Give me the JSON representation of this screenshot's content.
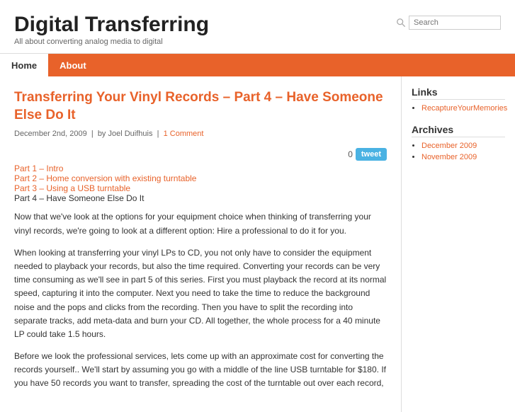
{
  "site": {
    "title": "Digital Transferring",
    "tagline": "All about converting analog media to digital",
    "search_placeholder": "Search"
  },
  "nav": {
    "items": [
      {
        "label": "Home",
        "active": true
      },
      {
        "label": "About",
        "active": false
      }
    ]
  },
  "post": {
    "title": "Transferring Your Vinyl Records – Part 4 – Have Someone Else Do It",
    "date": "December 2nd, 2009",
    "author": "Joel Duifhuis",
    "comment_label": "1 Comment",
    "tweet_count": "0",
    "tweet_button_label": "tweet",
    "nav_links": [
      {
        "label": "Part 1 – Intro",
        "linked": true
      },
      {
        "label": "Part 2 – Home conversion with existing turntable",
        "linked": true
      },
      {
        "label": "Part 3 – Using a USB turntable",
        "linked": true
      },
      {
        "label": "Part 4 – Have Someone Else Do It",
        "linked": false
      }
    ],
    "paragraphs": [
      "Now that we've look at the options for your equipment choice when thinking of transferring your vinyl records, we're going to look at a different option: Hire a professional to do it for you.",
      "When looking at transferring your vinyl LPs to CD, you not only have to consider the equipment needed to playback your records, but also the time required. Converting your records can be very time consuming as we'll see in part 5 of this series. First you must playback the record at its normal speed, capturing it into the computer. Next you need to take the time to reduce the background noise and the pops and clicks from the recording. Then you have to split the recording into separate tracks, add meta-data and burn your CD. All together, the whole process for a 40 minute LP could take 1.5 hours.",
      "Before we look the professional services, lets come up with an approximate cost for converting the records yourself.. We'll start by assuming you go with a middle of the line USB turntable for $180. If you have 50 records you want to transfer, spreading the cost of the turntable out over each record,"
    ]
  },
  "sidebar": {
    "links_heading": "Links",
    "links": [
      {
        "label": "RecaptureYourMemories"
      }
    ],
    "archives_heading": "Archives",
    "archives": [
      {
        "label": "December 2009"
      },
      {
        "label": "November 2009"
      }
    ]
  }
}
